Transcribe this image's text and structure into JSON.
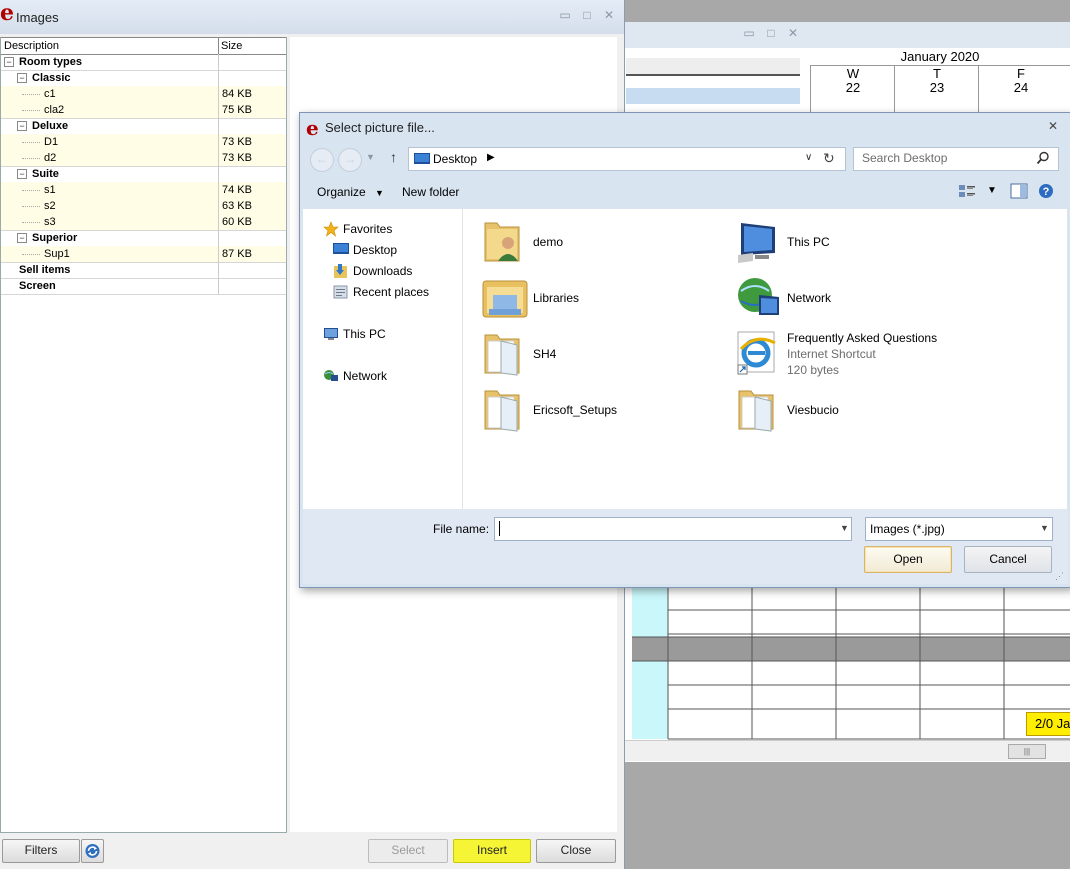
{
  "calendar": {
    "month": "January 2020",
    "days": [
      {
        "dow": "W",
        "num": "22"
      },
      {
        "dow": "T",
        "num": "23"
      },
      {
        "dow": "F",
        "num": "24"
      }
    ],
    "reservation_badge": "2/0 Ja"
  },
  "images_window": {
    "title": "Images",
    "columns": {
      "description": "Description",
      "size": "Size"
    },
    "tree": {
      "root": "Room types",
      "groups": [
        {
          "name": "Classic",
          "items": [
            {
              "name": "c1",
              "size": "84 KB"
            },
            {
              "name": "cla2",
              "size": "75 KB"
            }
          ]
        },
        {
          "name": "Deluxe",
          "items": [
            {
              "name": "D1",
              "size": "73 KB"
            },
            {
              "name": "d2",
              "size": "73 KB"
            }
          ]
        },
        {
          "name": "Suite",
          "items": [
            {
              "name": "s1",
              "size": "74 KB"
            },
            {
              "name": "s2",
              "size": "63 KB"
            },
            {
              "name": "s3",
              "size": "60 KB"
            }
          ]
        },
        {
          "name": "Superior",
          "items": [
            {
              "name": "Sup1",
              "size": "87 KB"
            }
          ]
        }
      ],
      "other_roots": [
        "Sell items",
        "Screen"
      ]
    },
    "buttons": {
      "filters": "Filters",
      "select": "Select",
      "insert": "Insert",
      "close": "Close"
    }
  },
  "dialog": {
    "title": "Select picture file...",
    "address": "Desktop",
    "search_placeholder": "Search Desktop",
    "toolbar": {
      "organize": "Organize",
      "new_folder": "New folder"
    },
    "nav": {
      "favorites": "Favorites",
      "desktop": "Desktop",
      "downloads": "Downloads",
      "recent": "Recent places",
      "this_pc": "This PC",
      "network": "Network"
    },
    "items": [
      {
        "name": "demo",
        "icon": "user-folder-icon"
      },
      {
        "name": "This PC",
        "icon": "computer-icon"
      },
      {
        "name": "Libraries",
        "icon": "libraries-icon"
      },
      {
        "name": "Network",
        "icon": "network-globe-icon"
      },
      {
        "name": "SH4",
        "icon": "folder-icon"
      },
      {
        "name": "Frequently Asked Questions",
        "sub1": "Internet Shortcut",
        "sub2": "120 bytes",
        "icon": "internet-explorer-icon"
      },
      {
        "name": "Ericsoft_Setups",
        "icon": "folder-icon"
      },
      {
        "name": "Viesbucio",
        "icon": "folder-icon"
      }
    ],
    "filename_label": "File name:",
    "filename_value": "",
    "filetype": "Images (*.jpg)",
    "open": "Open",
    "cancel": "Cancel"
  },
  "colors": {
    "insert_highlight": "#f5f536",
    "tree_leaf_bg": "#fffde6",
    "logo_red": "#b00000"
  }
}
